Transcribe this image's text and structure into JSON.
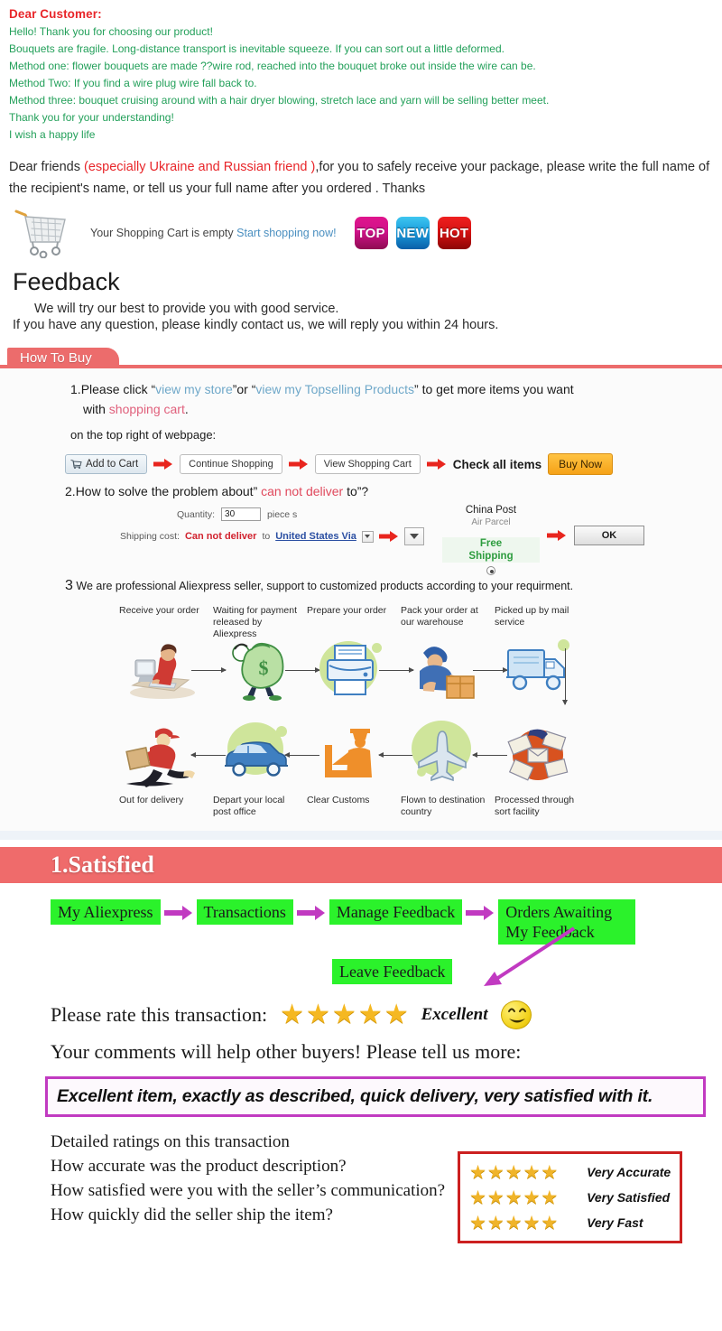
{
  "notice": {
    "heading": "Dear Customer:",
    "lines": [
      "Hello! Thank you for choosing our product!",
      "Bouquets are fragile. Long-distance transport is inevitable squeeze. If you can sort out a little deformed.",
      "Method one: flower bouquets are made ??wire rod, reached into the bouquet broke out inside the wire can be.",
      "Method Two: If you find a wire plug wire fall back to.",
      "Method three: bouquet cruising around with a hair dryer blowing, stretch lace and yarn will be selling better meet.",
      "Thank you for your understanding!",
      "I wish a happy life"
    ]
  },
  "friends": {
    "pre": "Dear friends ",
    "red": "(especially Ukraine and Russian friend )",
    "post": ",for you to safely receive your package, please write the full name of the recipient's name, or tell us your full name after you ordered . Thanks"
  },
  "cart": {
    "empty_text": "Your Shopping Cart is empty ",
    "link_text": "Start shopping now!",
    "badges": [
      {
        "label": "TOP",
        "color": "#d0128a"
      },
      {
        "label": "NEW",
        "color": "#1b9ede"
      },
      {
        "label": "HOT",
        "color": "#d61212"
      }
    ]
  },
  "feedback": {
    "title": "Feedback",
    "line1": "We will try our best to provide you with good service.",
    "line2": "If you have any question, please kindly contact us, we will reply you within 24 hours."
  },
  "how_to_buy": {
    "tab_label": "How To Buy",
    "accent_color": "#ec6c6c",
    "step1": {
      "num": "1.",
      "t1": "Please click “",
      "link1": "view my store",
      "t2": "”or “",
      "link2": "view my Topselling Products",
      "t3": "” to get  more items you want",
      "t4": "with ",
      "pink": "shopping cart",
      "t5": ".",
      "sub": "on the top right of webpage:"
    },
    "buttons": {
      "add_to_cart": "Add to Cart",
      "continue_shopping": "Continue Shopping",
      "view_cart": "View Shopping Cart",
      "check_all": "Check all items",
      "buy_now": "Buy Now"
    },
    "step2": {
      "num": "2.",
      "t1": "How to solve the problem about” ",
      "red": "can not deliver",
      "t2": " to”?"
    },
    "form": {
      "quantity_label": "Quantity:",
      "quantity_value": "30",
      "piece_label": "piece s",
      "shipping_label": "Shipping cost:",
      "cannot_deliver": "Can not deliver",
      "to_label": "to",
      "country": "United States Via",
      "carrier_line1": "China Post",
      "carrier_line2": "Air Parcel",
      "free_line1": "Free",
      "free_line2": "Shipping",
      "ok_label": "OK"
    },
    "step3": {
      "num": "3",
      "text": " We are professional Aliexpress seller, support to customized products according to your requirment."
    },
    "flow_top": [
      {
        "label": "Receive your order",
        "icon": "person-at-computer-icon"
      },
      {
        "label": "Waiting for payment released by Aliexpress",
        "icon": "money-bag-icon"
      },
      {
        "label": "Prepare your order",
        "icon": "printer-icon"
      },
      {
        "label": "Pack your order at our warehouse",
        "icon": "worker-packing-icon"
      },
      {
        "label": "Picked up by mail service",
        "icon": "mail-truck-icon"
      }
    ],
    "flow_bottom": [
      {
        "label": "Out for delivery",
        "icon": "courier-running-icon"
      },
      {
        "label": "Depart your local post office",
        "icon": "delivery-van-icon"
      },
      {
        "label": "Clear Customs",
        "icon": "customs-officer-icon"
      },
      {
        "label": "Flown to destination country",
        "icon": "airplane-icon"
      },
      {
        "label": "Processed through sort facility",
        "icon": "mail-sorting-icon"
      }
    ]
  },
  "satisfied": {
    "banner": "1.Satisfied",
    "banner_color": "#ef6b6b",
    "nav_boxes": [
      "My Aliexpress",
      "Transactions",
      "Manage Feedback",
      "Orders Awaiting My Feedback"
    ],
    "nav_box_color": "#2bf22b",
    "arrow_color": "#c13ac1",
    "leave_feedback": "Leave Feedback",
    "rate_prompt": "Please rate this transaction:",
    "rating_stars": 5,
    "rating_label": "Excellent",
    "comments_prompt": "Your comments will help other buyers! Please tell us more:",
    "comment_text": "Excellent item, exactly as described, quick delivery, very satisfied with it.",
    "detail_heading": "Detailed ratings on this transaction",
    "detail_questions": [
      "How accurate was the product description?",
      "How satisfied were you with the seller’s communication?",
      "How quickly did the seller ship the item?"
    ],
    "detail_ratings": [
      {
        "stars": 5,
        "label": "Very Accurate"
      },
      {
        "stars": 5,
        "label": "Very Satisfied"
      },
      {
        "stars": 5,
        "label": "Very Fast"
      }
    ],
    "detail_box_color": "#cc2020"
  }
}
